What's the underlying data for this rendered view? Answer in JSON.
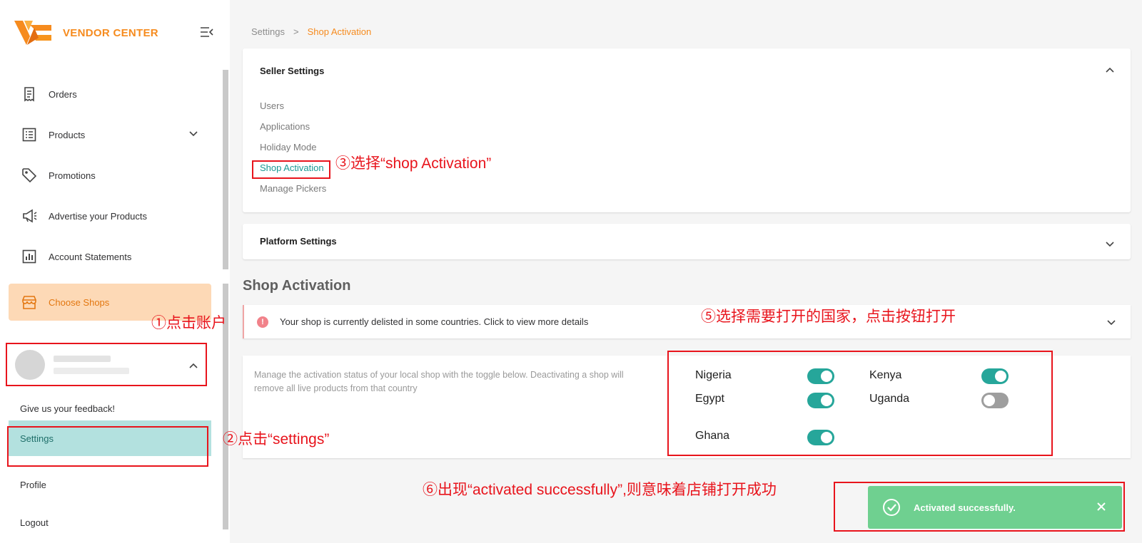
{
  "sidebar": {
    "brand": "VENDOR CENTER",
    "nav": [
      {
        "label": "Orders",
        "icon": "receipt-icon"
      },
      {
        "label": "Products",
        "icon": "list-icon"
      },
      {
        "label": "Promotions",
        "icon": "tag-icon"
      },
      {
        "label": "Advertise your Products",
        "icon": "megaphone-icon"
      },
      {
        "label": "Account Statements",
        "icon": "bar-chart-icon"
      },
      {
        "label": "Choose Shops",
        "icon": "store-icon"
      }
    ],
    "account_menu": [
      "Give us your feedback!",
      "Settings",
      "Profile",
      "Logout"
    ]
  },
  "breadcrumb": {
    "parent": "Settings",
    "separator": ">",
    "current": "Shop Activation"
  },
  "seller_settings": {
    "title": "Seller Settings",
    "links": [
      "Users",
      "Applications",
      "Holiday Mode",
      "Shop Activation",
      "Manage Pickers"
    ]
  },
  "platform_settings": {
    "title": "Platform Settings"
  },
  "shop_activation": {
    "title": "Shop Activation",
    "alert": "Your shop is currently delisted in some countries. Click to view more details",
    "description": "Manage the activation status of your local shop with the toggle below. Deactivating a shop will remove all live products from that country",
    "countries": [
      {
        "name": "Nigeria",
        "active": true
      },
      {
        "name": "Kenya",
        "active": true
      },
      {
        "name": "Egypt",
        "active": true
      },
      {
        "name": "Uganda",
        "active": false
      },
      {
        "name": "Ghana",
        "active": true
      }
    ]
  },
  "toast": {
    "message": "Activated successfully."
  },
  "annotations": {
    "step1": "①点击账户",
    "step2": "②点击“settings”",
    "step3": "③选择“shop Activation”",
    "step5": "⑤选择需要打开的国家，点击按钮打开",
    "step6": "⑥出现“activated successfully”,则意味着店铺打开成功"
  },
  "colors": {
    "brand_orange": "#f68b1e",
    "teal": "#26a69a",
    "annotation_red": "#e8141c",
    "toast_green": "#6fd090"
  }
}
